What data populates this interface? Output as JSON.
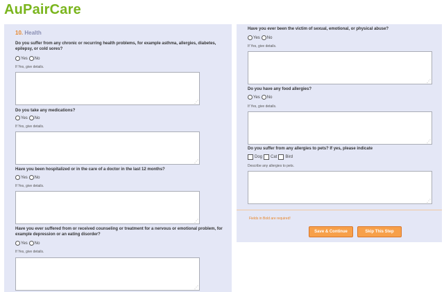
{
  "brand": {
    "logo": "AuPairCare"
  },
  "section": {
    "number": "10.",
    "title": "Health"
  },
  "questions": [
    {
      "text": "Do you suffer from any chronic or recurring health problems, for example asthma, allergies, diabetes, epilepsy, or cold sores?",
      "yes": "Yes",
      "no": "No",
      "hint": "If Yes, give details."
    },
    {
      "text": "Do you take any medications?",
      "yes": "Yes",
      "no": "No",
      "hint": "If Yes, give details."
    },
    {
      "text": "Have you been hospitalized or in the care of a doctor in the last 12 months?",
      "yes": "Yes",
      "no": "No",
      "hint": "If Yes, give details."
    },
    {
      "text": "Have you ever suffered from or received counseling or treatment for a nervous or emotional problem, for example depression or an eating disorder?",
      "yes": "Yes",
      "no": "No",
      "hint": "If Yes, give details."
    },
    {
      "text": "Have you ever been the victim of sexual, emotional, or physical abuse?",
      "yes": "Yes",
      "no": "No",
      "hint": "If Yes, give details."
    },
    {
      "text": "Do you have any food allergies?",
      "yes": "Yes",
      "no": "No",
      "hint": "If Yes, give details."
    }
  ],
  "pets": {
    "text": "Do you suffer from any allergies to pets? If yes, please indicate",
    "options": [
      "Dog",
      "Cat",
      "Bird"
    ],
    "hint": "Describe any allergies to pets."
  },
  "footer": {
    "required_note": "Fields in Bold are required!",
    "save_label": "Save & Continue",
    "skip_label": "Skip This Step"
  },
  "colors": {
    "brand": "#7ab51d",
    "accent": "#e8862a",
    "panel": "#e4e7f6",
    "button": "#f7a04a"
  },
  "icons": {
    "resize_grip": "resize-grip-icon"
  }
}
